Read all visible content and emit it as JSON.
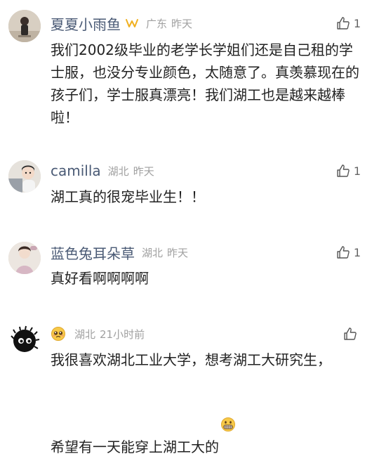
{
  "comments": [
    {
      "author": "夏夏小雨鱼",
      "badge_icon": "vip-crown-icon",
      "location": "广东",
      "time": "昨天",
      "likes": "1",
      "text": "我们2002级毕业的老学长学姐们还是自己租的学士服，也没分专业颜色，太随意了。真羡慕现在的孩子们，学士服真漂亮！我们湖工也是越来越棒啦！"
    },
    {
      "author": "camilla",
      "location": "湖北",
      "time": "昨天",
      "likes": "1",
      "text": "湖工真的很宠毕业生！！"
    },
    {
      "author": "蓝色兔耳朵草",
      "location": "湖北",
      "time": "昨天",
      "likes": "1",
      "text": "真好看啊啊啊啊"
    },
    {
      "author": "",
      "author_icon": "pleading-face-emoji-icon",
      "location": "湖北",
      "time": "21小时前",
      "likes": "",
      "text": "我很喜欢湖北工业大学，想考湖工大研究生，希望有一天能穿上湖工大的",
      "text_emoji": "grinning-face-emoji-icon"
    }
  ],
  "colors": {
    "author": "#4a5a75",
    "meta": "#a0a0a0",
    "text": "#222222",
    "like": "#666666",
    "badge": "#f0b020"
  }
}
